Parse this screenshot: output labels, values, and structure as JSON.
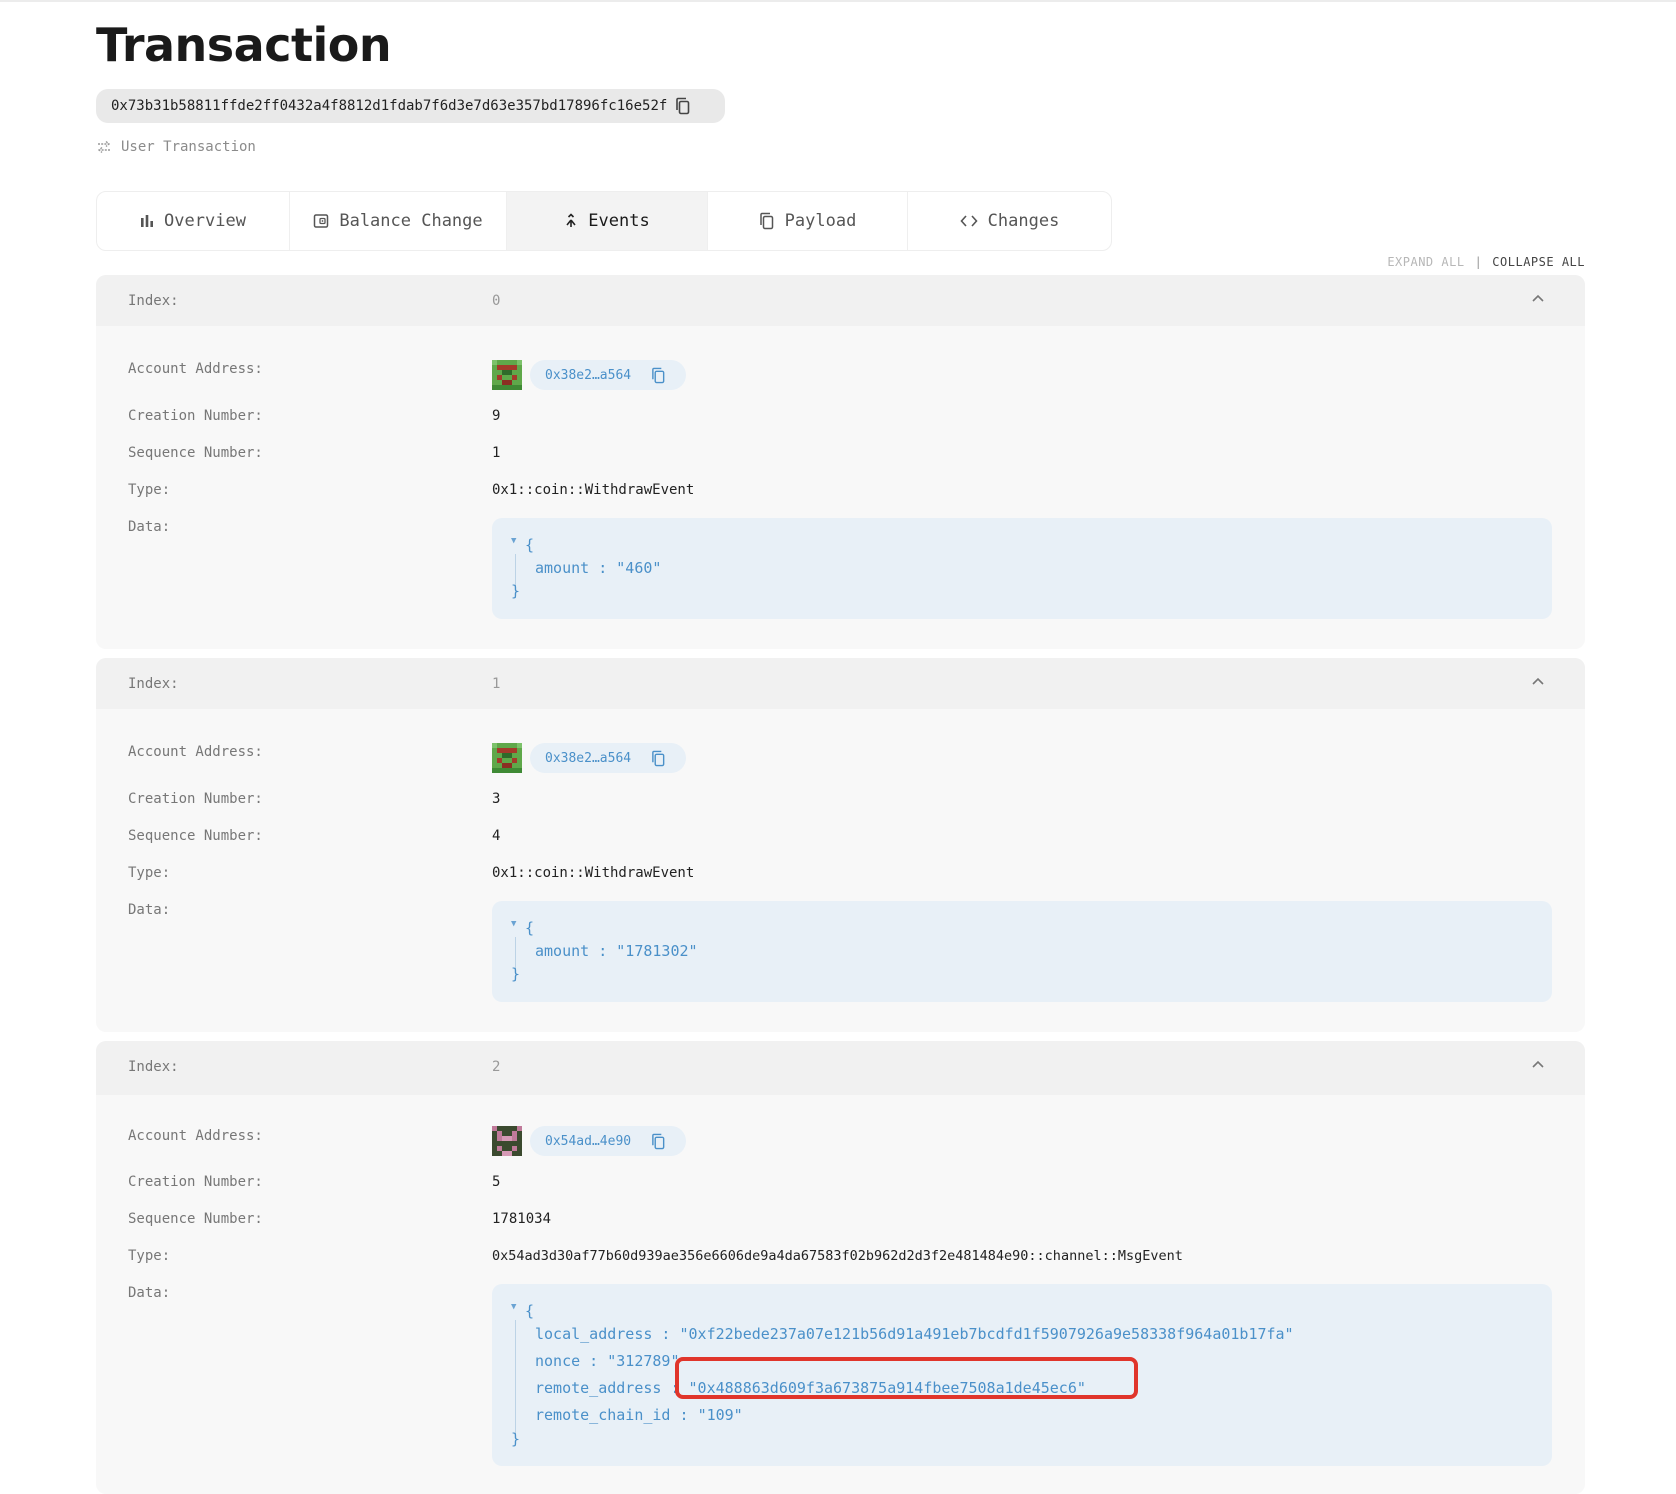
{
  "page": {
    "title": "Transaction",
    "tx_hash": "0x73b31b58811ffde2ff0432a4f8812d1fdab7f6d3e7d63e357bd17896fc16e52f",
    "tx_type": "User Transaction"
  },
  "tabs": [
    {
      "label": "Overview",
      "icon": "bar-chart-icon",
      "active": false
    },
    {
      "label": "Balance Change",
      "icon": "wallet-icon",
      "active": false
    },
    {
      "label": "Events",
      "icon": "merge-arrow-icon",
      "active": true
    },
    {
      "label": "Payload",
      "icon": "copy-icon",
      "active": false
    },
    {
      "label": "Changes",
      "icon": "code-icon",
      "active": false
    }
  ],
  "controls": {
    "expand_all": "EXPAND ALL",
    "separator": "|",
    "collapse_all": "COLLAPSE ALL"
  },
  "labels": {
    "index": "Index:",
    "account_address": "Account Address:",
    "creation_number": "Creation Number:",
    "sequence_number": "Sequence Number:",
    "type": "Type:",
    "data": "Data:"
  },
  "json_tokens": {
    "open": "{",
    "close": "}",
    "colon": " : "
  },
  "events": [
    {
      "index": "0",
      "account_address": "0x38e2…a564",
      "creation_number": "9",
      "sequence_number": "1",
      "type": "0x1::coin::WithdrawEvent",
      "data": [
        {
          "key": "amount",
          "value": "\"460\""
        }
      ]
    },
    {
      "index": "1",
      "account_address": "0x38e2…a564",
      "creation_number": "3",
      "sequence_number": "4",
      "type": "0x1::coin::WithdrawEvent",
      "data": [
        {
          "key": "amount",
          "value": "\"1781302\""
        }
      ]
    },
    {
      "index": "2",
      "account_address": "0x54ad…4e90",
      "creation_number": "5",
      "sequence_number": "1781034",
      "type": "0x54ad3d30af77b60d939ae356e6606de9a4da67583f02b962d2d3f2e481484e90::channel::MsgEvent",
      "data": [
        {
          "key": "local_address",
          "value": "\"0xf22bede237a07e121b56d91a491eb7bcdfd1f5907926a9e58338f964a01b17fa\""
        },
        {
          "key": "nonce",
          "value": "\"312789\""
        },
        {
          "key": "remote_address",
          "value": "\"0x488863d609f3a673875a914fbee7508a1de45ec6\""
        },
        {
          "key": "remote_chain_id",
          "value": "\"109\""
        }
      ]
    }
  ],
  "colors": {
    "accent_blue": "#4a90c9",
    "json_bg": "#e8f0f7",
    "highlight": "#e0352b"
  }
}
